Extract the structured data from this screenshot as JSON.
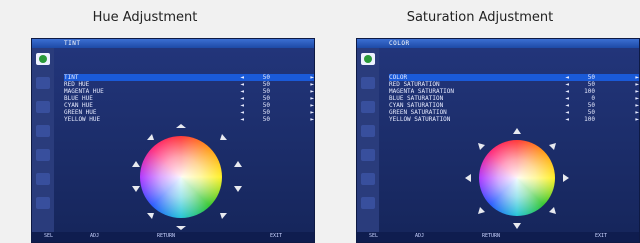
{
  "captions": {
    "left": "Hue Adjustment",
    "right": "Saturation Adjustment"
  },
  "left_panel": {
    "title": "TINT",
    "rows": [
      {
        "label": "TINT",
        "value": "50",
        "selected": true
      },
      {
        "label": "RED HUE",
        "value": "50"
      },
      {
        "label": "MAGENTA HUE",
        "value": "50"
      },
      {
        "label": "BLUE HUE",
        "value": "50"
      },
      {
        "label": "CYAN HUE",
        "value": "50"
      },
      {
        "label": "GREEN HUE",
        "value": "50"
      },
      {
        "label": "YELLOW HUE",
        "value": "50"
      }
    ],
    "bottom": [
      "SEL",
      "ADJ",
      "RETURN",
      "EXIT"
    ]
  },
  "right_panel": {
    "title": "COLOR",
    "rows": [
      {
        "label": "COLOR",
        "value": "50",
        "selected": true
      },
      {
        "label": "RED SATURATION",
        "value": "50"
      },
      {
        "label": "MAGENTA SATURATION",
        "value": "100"
      },
      {
        "label": "BLUE SATURATION",
        "value": "0"
      },
      {
        "label": "CYAN SATURATION",
        "value": "50"
      },
      {
        "label": "GREEN SATURATION",
        "value": "50"
      },
      {
        "label": "YELLOW SATURATION",
        "value": "100"
      }
    ],
    "bottom": [
      "SEL",
      "ADJ",
      "RETURN",
      "EXIT"
    ]
  },
  "colors": {
    "panel_bg": "#1b2c66",
    "title_bar": "#1d4aa6",
    "selected_row": "#1a5ad8",
    "text": "#e7ebff"
  },
  "icons": [
    "menu-category-icon",
    "left-arrow-icon",
    "right-arrow-icon",
    "color-wheel-icon"
  ]
}
